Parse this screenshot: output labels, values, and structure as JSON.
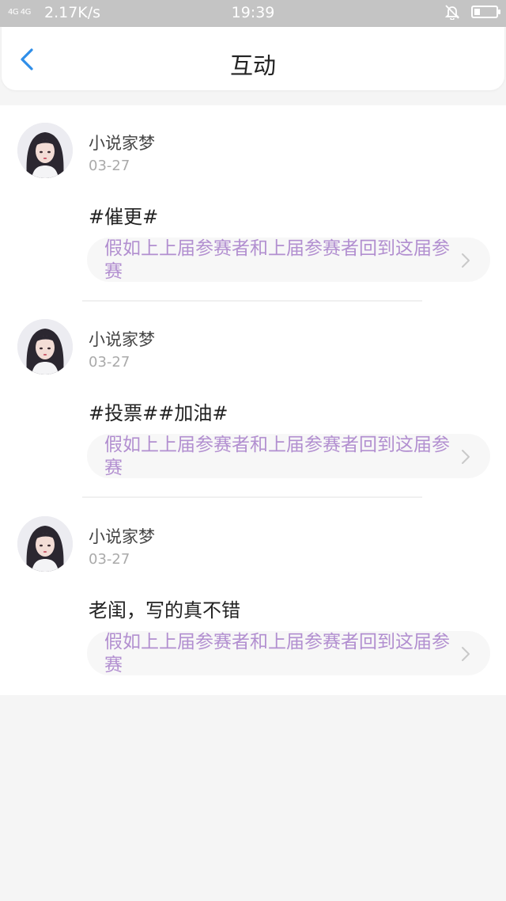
{
  "status_bar": {
    "network": "4G 4G",
    "speed": "2.17K/s",
    "time": "19:39",
    "icons": [
      "signal-icon",
      "bell-muted-icon",
      "battery-icon"
    ]
  },
  "header": {
    "title": "互动",
    "back_icon": "chevron-left-icon"
  },
  "items": [
    {
      "username": "小说家梦",
      "date": "03-27",
      "content": "#催更#",
      "ref_title": "假如上上届参赛者和上届参赛者回到这届参赛"
    },
    {
      "username": "小说家梦",
      "date": "03-27",
      "content": "#投票##加油#",
      "ref_title": "假如上上届参赛者和上届参赛者回到这届参赛"
    },
    {
      "username": "小说家梦",
      "date": "03-27",
      "content": "老闺，写的真不错",
      "ref_title": "假如上上届参赛者和上届参赛者回到这届参赛"
    }
  ],
  "colors": {
    "accent": "#2f8ee8",
    "ref_text": "#b28fd0",
    "status_bar_bg": "#c4c4c4",
    "page_bg": "#f5f5f5"
  }
}
